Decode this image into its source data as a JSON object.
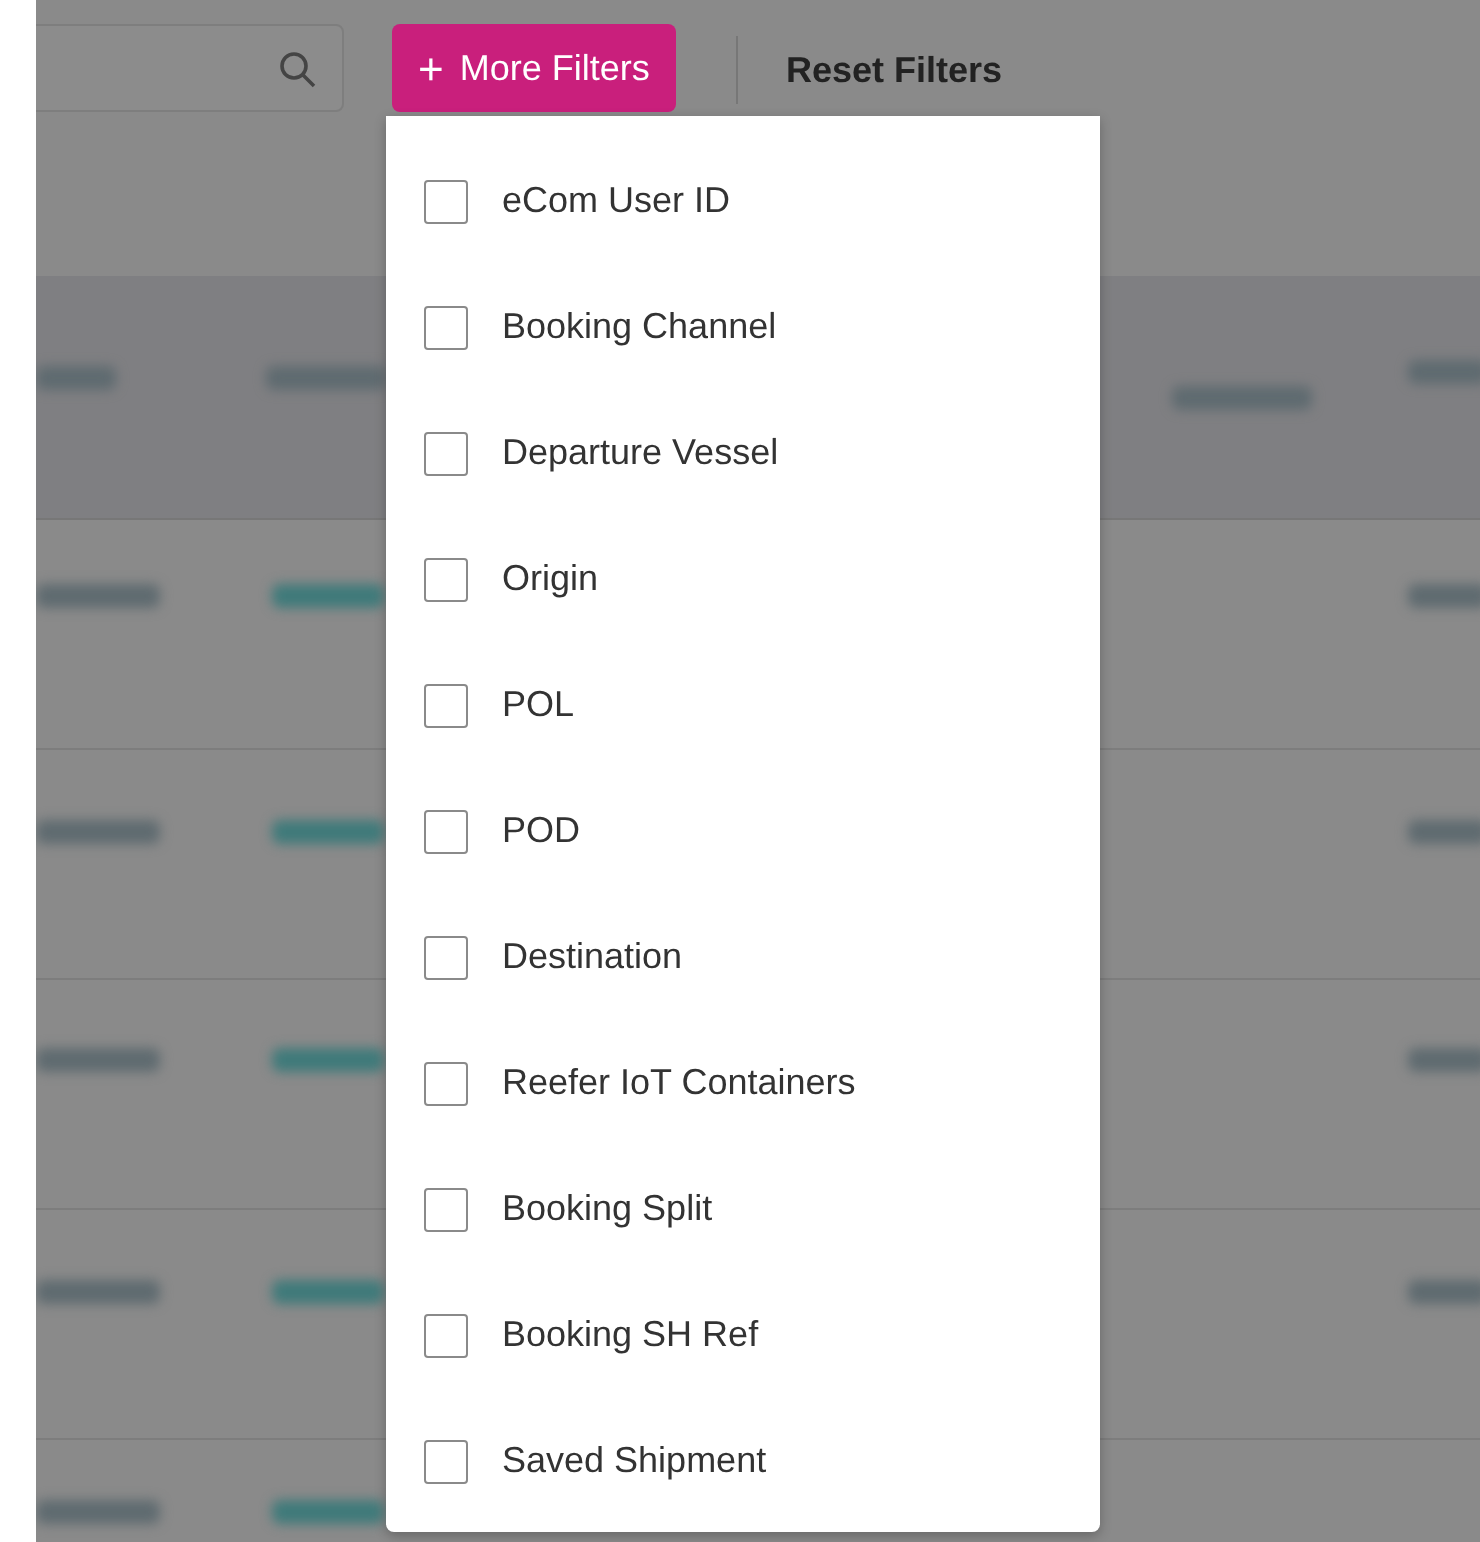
{
  "toolbar": {
    "more_filters_button": {
      "icon": "+",
      "label": "More Filters",
      "expanded": true
    },
    "reset_button": {
      "label": "Reset Filters"
    }
  },
  "filter_menu": {
    "items": [
      {
        "label": "eCom User ID",
        "checked": false
      },
      {
        "label": "Booking Channel",
        "checked": false
      },
      {
        "label": "Departure Vessel",
        "checked": false
      },
      {
        "label": "Origin",
        "checked": false
      },
      {
        "label": "POL",
        "checked": false
      },
      {
        "label": "POD",
        "checked": false
      },
      {
        "label": "Destination",
        "checked": false
      },
      {
        "label": "Reefer IoT Containers",
        "checked": false
      },
      {
        "label": "Booking Split",
        "checked": false
      },
      {
        "label": "Booking SH Ref",
        "checked": false
      },
      {
        "label": "Saved Shipment",
        "checked": false
      }
    ]
  }
}
